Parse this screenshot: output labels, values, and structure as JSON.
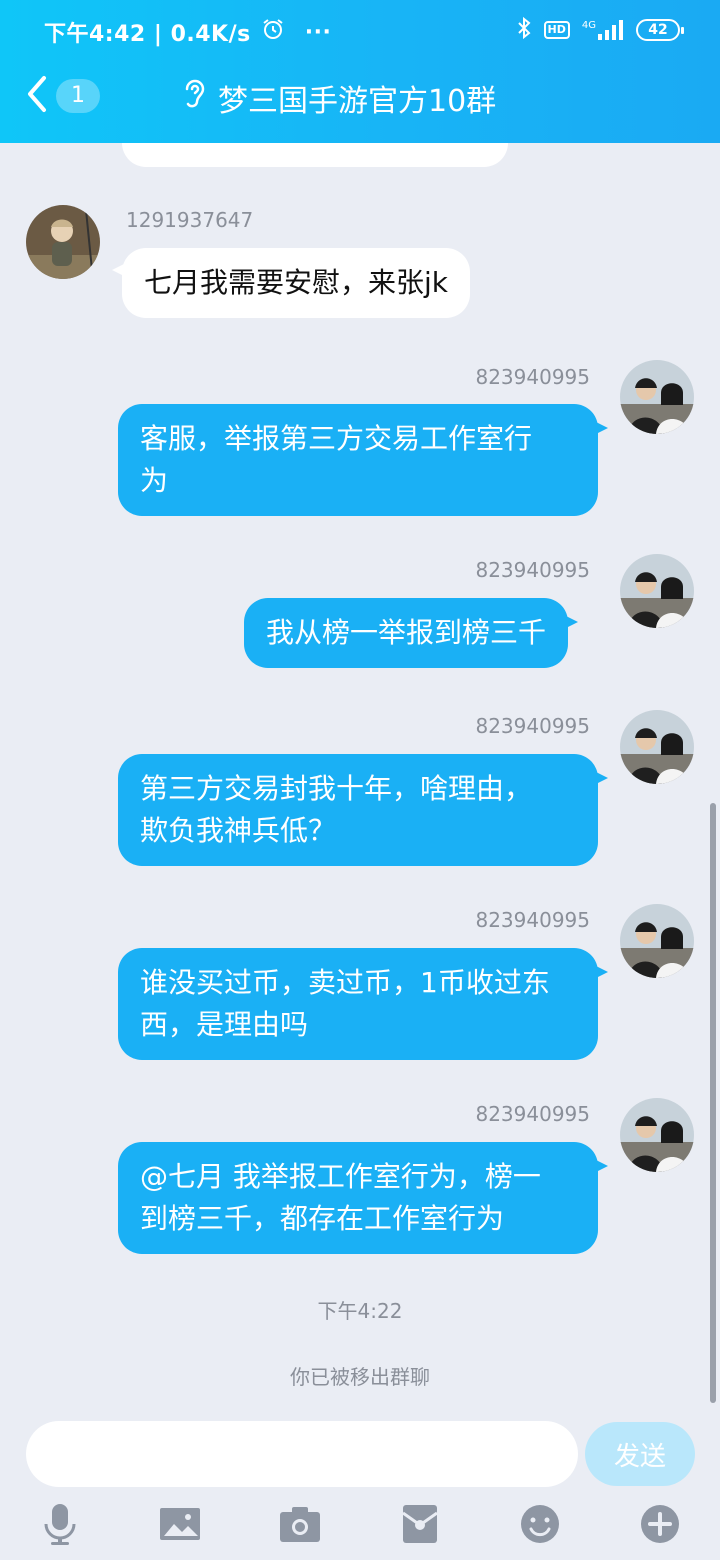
{
  "status_bar": {
    "time_speed": "下午4:42 | 0.4K/s",
    "more": "···",
    "hd": "HD",
    "network": "4G",
    "battery": "42"
  },
  "nav": {
    "unread_count": "1",
    "title": "梦三国手游官方10群"
  },
  "messages": [
    {
      "sender": "1291937647",
      "text": "七月我需要安慰，来张jk",
      "side": "left"
    },
    {
      "sender": "823940995",
      "lines": [
        "客服，举报第三方交易工作室行",
        "为"
      ],
      "side": "right"
    },
    {
      "sender": "823940995",
      "text": "我从榜一举报到榜三千",
      "side": "right"
    },
    {
      "sender": "823940995",
      "lines": [
        "第三方交易封我十年，啥理由，",
        "欺负我神兵低？"
      ],
      "side": "right"
    },
    {
      "sender": "823940995",
      "lines": [
        "谁没买过币，卖过币，1币收过东",
        "西，是理由吗"
      ],
      "side": "right"
    },
    {
      "sender": "823940995",
      "lines": [
        "@七月 我举报工作室行为，榜一",
        "到榜三千，都存在工作室行为"
      ],
      "side": "right"
    }
  ],
  "timestamp": "下午4:22",
  "system_notice": "你已被移出群聊",
  "input": {
    "value": "",
    "send_label": "发送"
  },
  "toolbar_icons": [
    "mic-icon",
    "image-icon",
    "camera-icon",
    "red-packet-icon",
    "emoji-icon",
    "plus-icon"
  ],
  "colors": {
    "header": "#18b4f6",
    "bubble_self": "#1ab0f5",
    "bubble_other": "#ffffff",
    "background": "#eaedf4"
  }
}
